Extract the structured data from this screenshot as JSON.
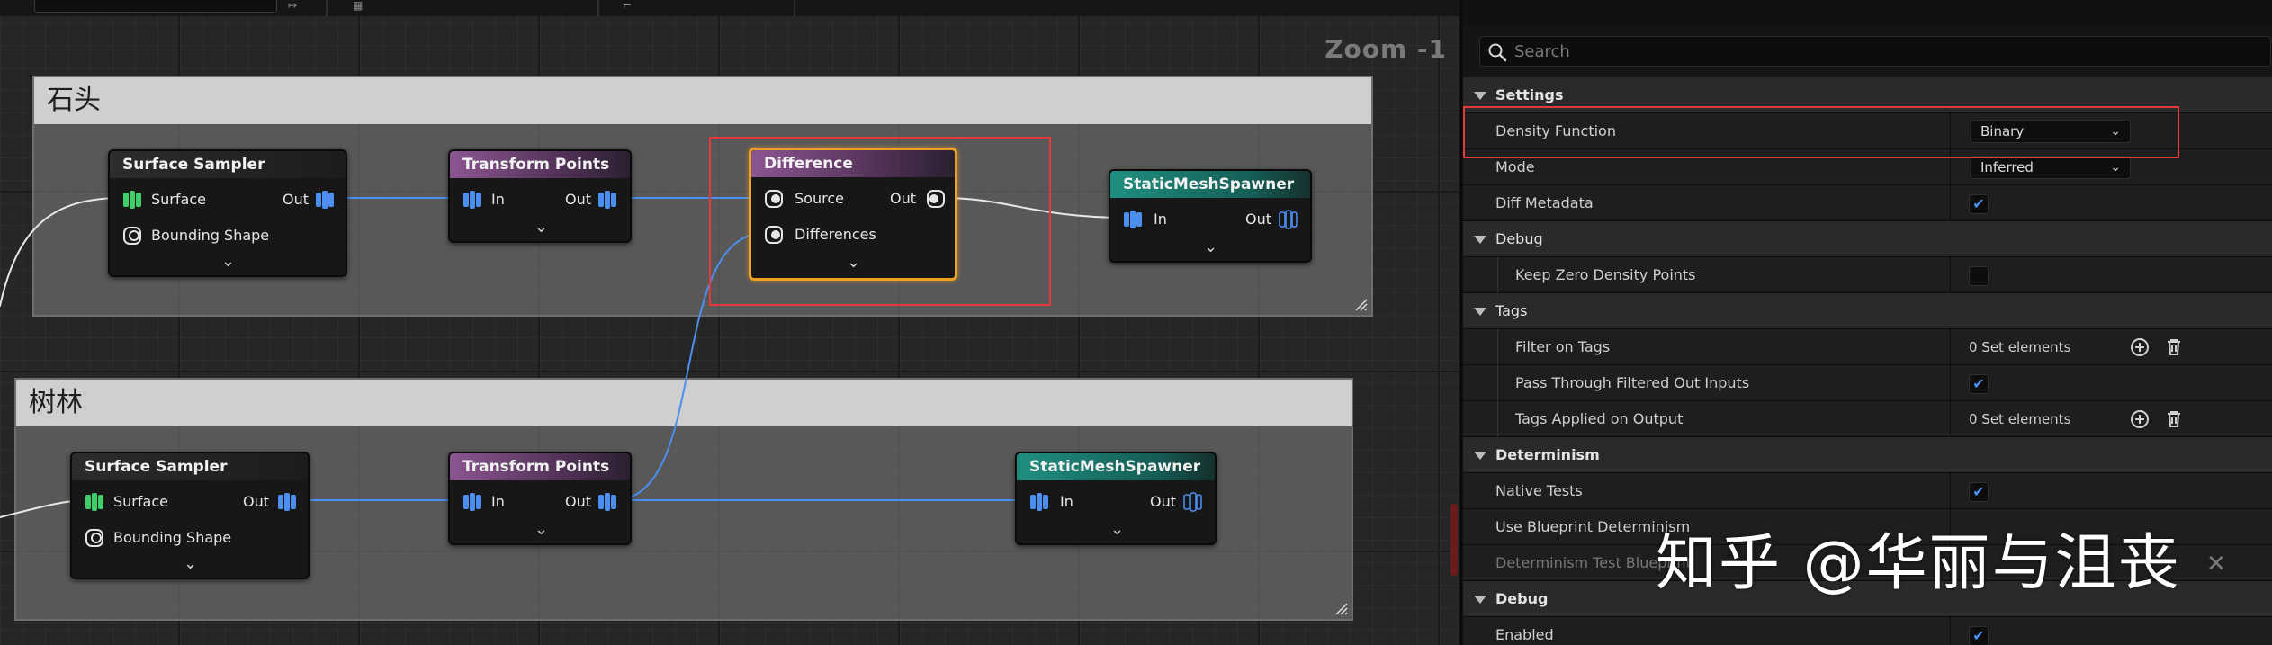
{
  "graph": {
    "zoom_label": "Zoom -1",
    "comments": [
      {
        "title": "石头"
      },
      {
        "title": "树林"
      }
    ],
    "nodes": {
      "sampler1": {
        "title": "Surface Sampler",
        "pin_in1": "Surface",
        "pin_in2": "Bounding Shape",
        "pin_out": "Out"
      },
      "transform1": {
        "title": "Transform Points",
        "pin_in": "In",
        "pin_out": "Out"
      },
      "difference": {
        "title": "Difference",
        "pin_in1": "Source",
        "pin_in2": "Differences",
        "pin_out": "Out"
      },
      "spawner1": {
        "title": "StaticMeshSpawner",
        "pin_in": "In",
        "pin_out": "Out"
      },
      "sampler2": {
        "title": "Surface Sampler",
        "pin_in1": "Surface",
        "pin_in2": "Bounding Shape",
        "pin_out": "Out"
      },
      "transform2": {
        "title": "Transform Points",
        "pin_in": "In",
        "pin_out": "Out"
      },
      "spawner2": {
        "title": "StaticMeshSpawner",
        "pin_in": "In",
        "pin_out": "Out"
      }
    },
    "colors": {
      "wire_point": "#4b8ff0",
      "wire_exec": "#e8e8e8",
      "selection": "#f0a020",
      "annotation": "#e43a3a",
      "pin_green": "#3fcf6a",
      "pin_blue": "#4b8ff0"
    }
  },
  "details": {
    "search_placeholder": "Search",
    "sections": {
      "settings": "Settings",
      "debug1": "Debug",
      "tags": "Tags",
      "determinism": "Determinism",
      "debug2": "Debug"
    },
    "props": {
      "density_function": {
        "label": "Density Function",
        "value": "Binary"
      },
      "mode": {
        "label": "Mode",
        "value": "Inferred"
      },
      "diff_metadata": {
        "label": "Diff Metadata",
        "checked": true
      },
      "keep_zero": {
        "label": "Keep Zero Density Points",
        "checked": false
      },
      "filter_tags": {
        "label": "Filter on Tags",
        "value": "0 Set elements"
      },
      "pass_through": {
        "label": "Pass Through Filtered Out Inputs",
        "checked": true
      },
      "tags_applied": {
        "label": "Tags Applied on Output",
        "value": "0 Set elements"
      },
      "native_tests": {
        "label": "Native Tests",
        "checked": true
      },
      "use_blueprint": {
        "label": "Use Blueprint Determinism"
      },
      "test_blueprint": {
        "label": "Determinism Test Blueprint"
      },
      "enabled": {
        "label": "Enabled",
        "checked": true
      }
    },
    "check_glyph": "✔"
  },
  "watermark": "知乎 @华丽与沮丧"
}
